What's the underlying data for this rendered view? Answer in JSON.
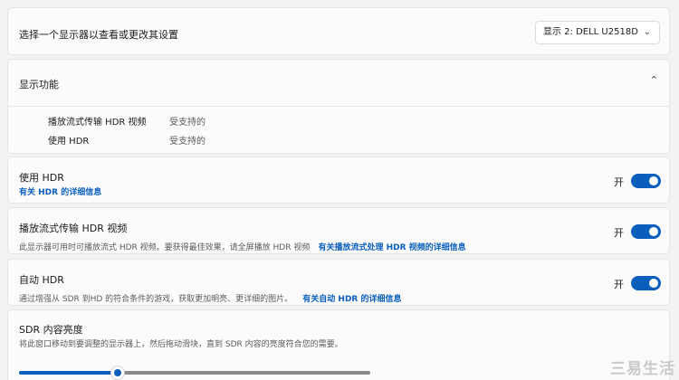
{
  "display_select": {
    "title": "选择一个显示器以查看或更改其设置",
    "dropdown_value": "显示 2: DELL U2518D"
  },
  "capabilities": {
    "title": "显示功能",
    "rows": [
      {
        "label": "播放流式传输 HDR 视频",
        "value": "受支持的"
      },
      {
        "label": "使用 HDR",
        "value": "受支持的"
      }
    ]
  },
  "use_hdr": {
    "title": "使用 HDR",
    "link": "有关 HDR 的详细信息",
    "state": "开",
    "on": true
  },
  "stream_hdr": {
    "title": "播放流式传输 HDR 视频",
    "description": "此显示器可用时可播放流式 HDR 视频。要获得最佳效果，请全屏播放 HDR 视频",
    "link": "有关播放流式处理 HDR 视频的详细信息",
    "state": "开",
    "on": true
  },
  "auto_hdr": {
    "title": "自动 HDR",
    "description": "通过增强从 SDR 到HD 的符合条件的游戏，获取更加明亮、更详细的图片。",
    "link": "有关自动 HDR 的详细信息",
    "state": "开",
    "on": true
  },
  "sdr_brightness": {
    "title": "SDR 内容亮度",
    "description": "将此窗口移动到要调整的显示器上，然后拖动滑块，直到 SDR 内容的亮度符合您的需要。",
    "value_fraction": 0.28
  },
  "watermark": "三易生活",
  "colors": {
    "accent": "#0a5fbd",
    "background": "#f3f3f3",
    "card": "#fbfbfb"
  }
}
